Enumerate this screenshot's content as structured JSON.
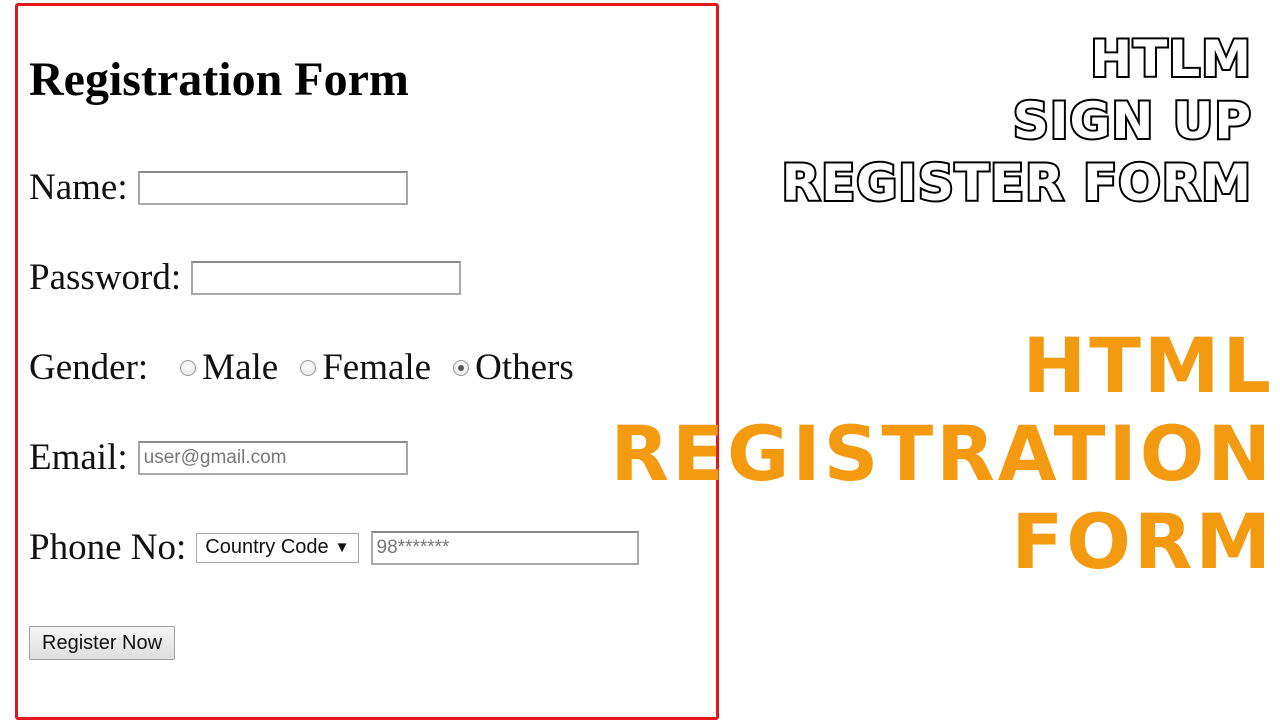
{
  "form": {
    "title": "Registration Form",
    "name_label": "Name:",
    "name_value": "",
    "password_label": "Password:",
    "password_value": "",
    "gender_label": "Gender:",
    "gender_options": [
      {
        "label": "Male",
        "checked": false
      },
      {
        "label": "Female",
        "checked": false
      },
      {
        "label": "Others",
        "checked": true
      }
    ],
    "email_label": "Email:",
    "email_placeholder": "user@gmail.com",
    "phone_label": "Phone No:",
    "country_code_selected": "Country Code",
    "phone_placeholder": "98*******",
    "register_button": "Register Now"
  },
  "caption_top": [
    "HTLM",
    "SIGN UP",
    "REGISTER FORM"
  ],
  "caption_main": [
    "HTML",
    "REGISTRATION",
    "FORM"
  ],
  "colors": {
    "frame_border": "#e3161d",
    "caption_main": "#f39a11",
    "caption_top_fill": "#ffffff",
    "caption_top_stroke": "#000000"
  },
  "icons": {
    "select_arrow": "chevron-down-icon"
  }
}
